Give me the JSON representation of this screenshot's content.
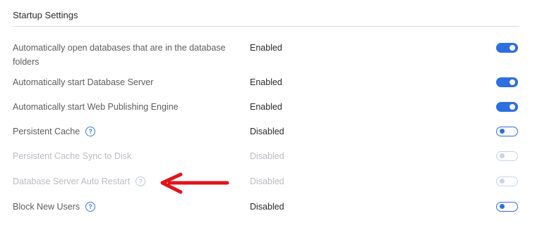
{
  "section": {
    "title": "Startup Settings"
  },
  "rows": [
    {
      "label": "Automatically open databases that are in the database folders",
      "value": "Enabled",
      "toggle": "on"
    },
    {
      "label": "Automatically start Database Server",
      "value": "Enabled",
      "toggle": "on"
    },
    {
      "label": "Automatically start Web Publishing Engine",
      "value": "Enabled",
      "toggle": "on"
    },
    {
      "label": "Persistent Cache",
      "value": "Disabled",
      "toggle": "off",
      "help": "?"
    },
    {
      "label": "Persistent Cache Sync to Disk",
      "value": "Disabled",
      "toggle": "off",
      "disabled": true
    },
    {
      "label": "Database Server Auto Restart",
      "value": "Disabled",
      "toggle": "off",
      "disabled": true,
      "help": "?"
    },
    {
      "label": "Block New Users",
      "value": "Disabled",
      "toggle": "off",
      "help": "?"
    }
  ],
  "colors": {
    "accent": "#2d6fde",
    "annotation_arrow": "#e0141b"
  }
}
